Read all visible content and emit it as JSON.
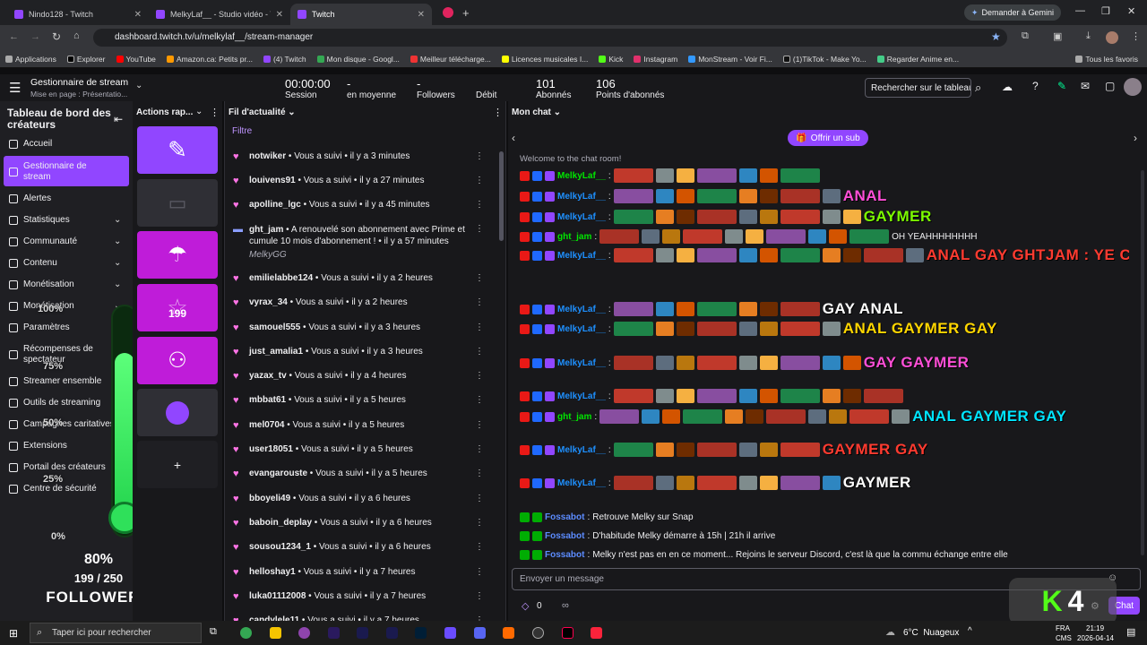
{
  "browser": {
    "tabs": [
      {
        "title": "Nindo128 - Twitch"
      },
      {
        "title": "MelkyLaf__ - Studio vidéo - Tw"
      },
      {
        "title": "Twitch"
      }
    ],
    "gemini_label": "Demander à Gemini",
    "url": "dashboard.twitch.tv/u/melkylaf__/stream-manager",
    "bookmarks": [
      "Applications",
      "Explorer",
      "YouTube",
      "Amazon.ca: Petits pr...",
      "(4) Twitch",
      "Mon disque - Googl...",
      "Meilleur télécharge...",
      "Licences musicales I...",
      "Kick",
      "Instagram",
      "MonStream - Voir Fi...",
      "(1)TikTok - Make Yo...",
      "Regarder Anime en..."
    ],
    "all_bookmarks": "Tous les favoris"
  },
  "topbar": {
    "title": "Gestionnaire de stream",
    "subtitle": "Mise en page : Présentatio...",
    "stats": [
      {
        "value": "00:00:00",
        "label": "Session"
      },
      {
        "value": "-",
        "label": "en moyenne"
      },
      {
        "value": "-",
        "label": "Followers"
      },
      {
        "value": "",
        "label": "Débit"
      },
      {
        "value": "101",
        "label": "Abonnés"
      },
      {
        "value": "106",
        "label": "Points d'abonnés"
      }
    ],
    "search_placeholder": "Rechercher sur le tableau"
  },
  "sidebar": {
    "header": "Tableau de bord des créateurs",
    "items": [
      {
        "label": "Accueil",
        "icon": "home-icon"
      },
      {
        "label": "Gestionnaire de stream",
        "icon": "broadcast-icon",
        "active": true
      },
      {
        "label": "Alertes",
        "icon": "alert-icon"
      },
      {
        "label": "Statistiques",
        "icon": "stats-icon",
        "chevron": true
      },
      {
        "label": "Communauté",
        "icon": "community-icon",
        "chevron": true
      },
      {
        "label": "Contenu",
        "icon": "content-icon",
        "chevron": true
      },
      {
        "label": "Monétisation",
        "icon": "money-icon",
        "chevron": true
      },
      {
        "label": "Monétisation",
        "icon": "pen-icon",
        "chevron": true
      },
      {
        "label": "Paramètres",
        "icon": "settings-icon",
        "chevron": true
      },
      {
        "label": "Récompenses de spectateur",
        "icon": "reward-icon",
        "chevron": true
      },
      {
        "label": "Streamer ensemble",
        "icon": "together-icon"
      },
      {
        "label": "Outils de streaming",
        "icon": "tools-icon"
      },
      {
        "label": "Campagnes caritatives",
        "icon": "charity-icon"
      },
      {
        "label": "Extensions",
        "icon": "extensions-icon"
      },
      {
        "label": "Portail des créateurs",
        "icon": "portal-icon"
      },
      {
        "label": "Centre de sécurité",
        "icon": "shield-icon"
      }
    ]
  },
  "goal_overlay": {
    "ticks": [
      "100%",
      "75%",
      "50%",
      "25%",
      "0%"
    ],
    "percent": "80%",
    "progress": 0.8,
    "count": "199 / 250",
    "label": "FOLLOWERS"
  },
  "quick_actions": {
    "title": "Actions rap...",
    "star_count": "199"
  },
  "feed": {
    "title": "Fil d'actualité",
    "filter": "Filtre",
    "items": [
      {
        "user": "notwiker",
        "action": "Vous a suivi",
        "time": "il y a 3 minutes"
      },
      {
        "user": "louivens91",
        "action": "Vous a suivi",
        "time": "il y a 27 minutes"
      },
      {
        "user": "apolline_lgc",
        "action": "Vous a suivi",
        "time": "il y a 45 minutes"
      },
      {
        "user": "ght_jam",
        "action": "A renouvelé son abonnement",
        "extra": "avec Prime et cumule 10 mois d'abonnement !",
        "time": "il y a 57 minutes",
        "message": "MelkyGG"
      },
      {
        "user": "emilielabbe124",
        "action": "Vous a suivi",
        "time": "il y a 2 heures"
      },
      {
        "user": "vyrax_34",
        "action": "Vous a suivi",
        "time": "il y a 2 heures"
      },
      {
        "user": "samouel555",
        "action": "Vous a suivi",
        "time": "il y a 3 heures"
      },
      {
        "user": "just_amalia1",
        "action": "Vous a suivi",
        "time": "il y a 3 heures"
      },
      {
        "user": "yazax_tv",
        "action": "Vous a suivi",
        "time": "il y a 4 heures"
      },
      {
        "user": "mbbat61",
        "action": "Vous a suivi",
        "time": "il y a 5 heures"
      },
      {
        "user": "mel0704",
        "action": "Vous a suivi",
        "time": "il y a 5 heures"
      },
      {
        "user": "user18051",
        "action": "Vous a suivi",
        "time": "il y a 5 heures"
      },
      {
        "user": "evangarouste",
        "action": "Vous a suivi",
        "time": "il y a 5 heures"
      },
      {
        "user": "bboyeli49",
        "action": "Vous a suivi",
        "time": "il y a 6 heures"
      },
      {
        "user": "baboin_deplay",
        "action": "Vous a suivi",
        "time": "il y a 6 heures"
      },
      {
        "user": "sousou1234_1",
        "action": "Vous a suivi",
        "time": "il y a 6 heures"
      },
      {
        "user": "helloshay1",
        "action": "Vous a suivi",
        "time": "il y a 7 heures"
      },
      {
        "user": "luka01112008",
        "action": "Vous a suivi",
        "time": "il y a 7 heures"
      },
      {
        "user": "candylele11",
        "action": "Vous a suivi",
        "time": "il y a 7 heures"
      }
    ]
  },
  "chat": {
    "title": "Mon chat",
    "sub_button": "Offrir un sub",
    "welcome": "Welcome to the chat room!",
    "messages": [
      {
        "user": "MelkyLaf__",
        "color": "#00e600",
        "text": ""
      },
      {
        "user": "MelkyLaf__",
        "color": "#1e90ff",
        "text": "ANAL"
      },
      {
        "user": "MelkyLaf__",
        "color": "#1e90ff",
        "text": "GAYMER"
      },
      {
        "user": "ght_jam",
        "color": "#00e600",
        "text": "OH YEAHHHHHHHH"
      },
      {
        "user": "MelkyLaf__",
        "color": "#1e90ff",
        "text": "ANAL  GAY  GHTJAM : YE C MARCHER  ANAL"
      },
      {
        "user": "MelkyLaf__",
        "color": "#1e90ff",
        "text": "GAY  ANAL"
      },
      {
        "user": "MelkyLaf__",
        "color": "#1e90ff",
        "text": "ANAL  GAYMER  GAY"
      },
      {
        "user": "MelkyLaf__",
        "color": "#1e90ff",
        "text": "GAY  GAYMER"
      },
      {
        "user": "MelkyLaf__",
        "color": "#1e90ff",
        "text": ""
      },
      {
        "user": "ght_jam",
        "color": "#00e600",
        "text": "ANAL  GAYMER  GAY"
      },
      {
        "user": "MelkyLaf__",
        "color": "#1e90ff",
        "text": "GAYMER  GAY"
      },
      {
        "user": "MelkyLaf__",
        "color": "#1e90ff",
        "text": "GAYMER"
      }
    ],
    "bot_messages": [
      {
        "user": "Fossabot",
        "text": "Retrouve Melky sur  Snap"
      },
      {
        "user": "Fossabot",
        "text": "D'habitude Melky démarre à 15h  | 21h  il arrive"
      },
      {
        "user": "Fossabot",
        "text": "Melky n'est pas en  en ce moment... Rejoins le serveur Discord, c'est là que la commu échange entre elle"
      }
    ],
    "input_placeholder": "Envoyer un message",
    "points": "0",
    "infinity": "∞",
    "chat_button": "Chat"
  },
  "taskbar": {
    "search": "Taper ici pour rechercher",
    "weather": "6°C  Nuageux",
    "lang": "FRA",
    "lang2": "CMS",
    "time": "21:19",
    "date": "2026-04-14"
  },
  "overlay_logo": "4"
}
